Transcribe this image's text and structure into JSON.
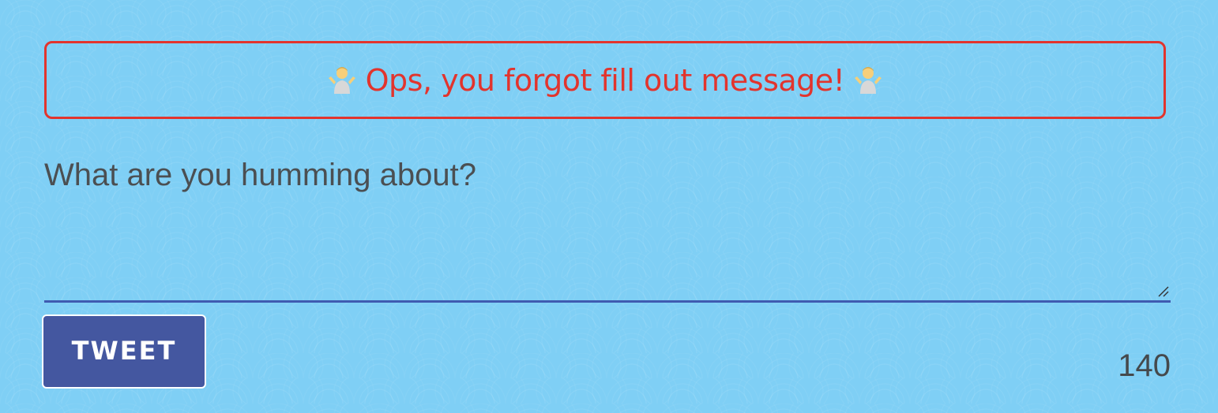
{
  "error": {
    "message": "Ops, you forgot fill out message!",
    "icon": "person-shrugging-icon",
    "color": "#e2342d"
  },
  "composer": {
    "placeholder": "What are you humming about?",
    "value": ""
  },
  "tweet_button": {
    "label": "TWEET",
    "color": "#4457a0"
  },
  "char_counter": {
    "remaining": "140"
  },
  "colors": {
    "background": "#7fcff5",
    "underline": "#3f5bb0",
    "text": "#4b4f52"
  }
}
